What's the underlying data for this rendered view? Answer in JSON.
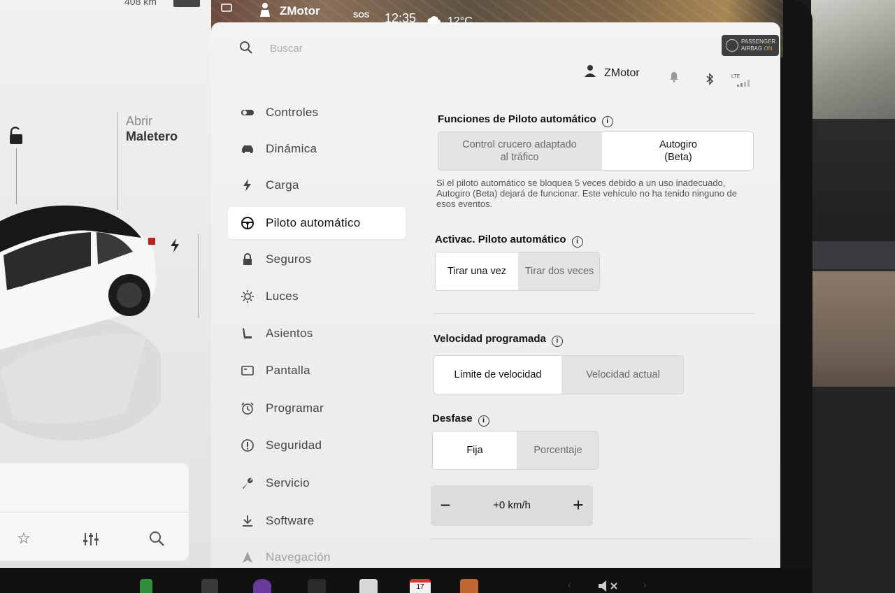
{
  "status_bar": {
    "profile_name": "ZMotor",
    "sos_label": "SOS",
    "time": "12:35",
    "temperature": "12°C",
    "airbag_line1": "PASSENGER",
    "airbag_line2": "AIRBAG",
    "airbag_state": "ON"
  },
  "car_panel": {
    "range": "408 km",
    "trunk_label_line1": "Abrir",
    "trunk_label_line2": "Maletero"
  },
  "settings": {
    "search_placeholder": "Buscar",
    "user_name": "ZMotor",
    "lte_label": "LTE",
    "nav": [
      {
        "label": "Controles",
        "icon": "toggle-icon"
      },
      {
        "label": "Dinámica",
        "icon": "car-icon"
      },
      {
        "label": "Carga",
        "icon": "bolt-icon"
      },
      {
        "label": "Piloto automático",
        "icon": "steering-wheel-icon"
      },
      {
        "label": "Seguros",
        "icon": "lock-icon"
      },
      {
        "label": "Luces",
        "icon": "sun-icon"
      },
      {
        "label": "Asientos",
        "icon": "seat-icon"
      },
      {
        "label": "Pantalla",
        "icon": "display-icon"
      },
      {
        "label": "Programar",
        "icon": "alarm-clock-icon"
      },
      {
        "label": "Seguridad",
        "icon": "alert-circle-icon"
      },
      {
        "label": "Servicio",
        "icon": "wrench-icon"
      },
      {
        "label": "Software",
        "icon": "download-icon"
      },
      {
        "label": "Navegación",
        "icon": "navigation-icon"
      }
    ],
    "active_nav": "Piloto automático",
    "autopilot_features": {
      "title": "Funciones de Piloto automático",
      "option1": "Control crucero adaptado al tráfico",
      "option2_line1": "Autogiro",
      "option2_line2": "(Beta)",
      "selected": "Autogiro (Beta)",
      "description": "Si el piloto automático se bloquea 5 veces debido a un uso inadecuado, Autogiro (Beta) dejará de funcionar. Este vehículo no ha tenido ninguno de esos eventos."
    },
    "activation": {
      "title": "Activac. Piloto automático",
      "option1": "Tirar una vez",
      "option2": "Tirar dos veces",
      "selected": "Tirar una vez"
    },
    "set_speed": {
      "title": "Velocidad programada",
      "option1": "Límite de velocidad",
      "option2": "Velocidad actual",
      "selected": "Límite de velocidad"
    },
    "offset": {
      "title": "Desfase",
      "option1": "Fija",
      "option2": "Porcentaje",
      "selected": "Fija",
      "value": "+0 km/h",
      "minus": "−",
      "plus": "+"
    }
  },
  "dock": {
    "calendar_day": "17"
  },
  "colors": {
    "selected_segment": "#ffffff",
    "segment_bg": "#e4e4e2",
    "airbag_on": "#f0a030"
  }
}
